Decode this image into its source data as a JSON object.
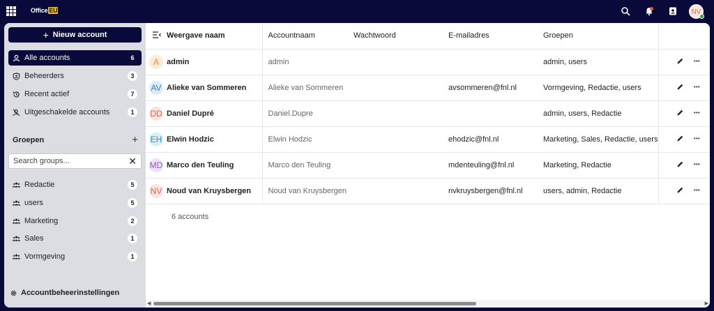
{
  "topbar": {
    "brand": "Office",
    "brand_suffix": "EU",
    "user_initials": "NV",
    "icons": [
      "apps-grid-icon",
      "search-icon",
      "bell-icon",
      "contacts-icon"
    ]
  },
  "sidebar": {
    "new_account_label": "Nieuw account",
    "nav": [
      {
        "label": "Alle accounts",
        "count": "6",
        "icon": "user-icon",
        "active": true
      },
      {
        "label": "Beheerders",
        "count": "3",
        "icon": "shield-user-icon",
        "active": false
      },
      {
        "label": "Recent actief",
        "count": "7",
        "icon": "history-icon",
        "active": false
      },
      {
        "label": "Uitgeschakelde accounts",
        "count": "1",
        "icon": "user-off-icon",
        "active": false
      }
    ],
    "groups_title": "Groepen",
    "search_placeholder": "Search groups...",
    "groups": [
      {
        "label": "Redactie",
        "count": "5"
      },
      {
        "label": "users",
        "count": "5"
      },
      {
        "label": "Marketing",
        "count": "2"
      },
      {
        "label": "Sales",
        "count": "1"
      },
      {
        "label": "Vormgeving",
        "count": "1"
      }
    ],
    "settings_label": "Accountbeheerinstellingen"
  },
  "table": {
    "headers": {
      "name": "Weergave naam",
      "account": "Accountnaam",
      "password": "Wachtwoord",
      "email": "E-mailadres",
      "groups": "Groepen"
    },
    "rows": [
      {
        "initials": "A",
        "avatar_bg": "#fdebd9",
        "avatar_fg": "#e0894a",
        "name": "admin",
        "account": "admin",
        "email": "",
        "groups": "admin, users"
      },
      {
        "initials": "AV",
        "avatar_bg": "#dcecfa",
        "avatar_fg": "#3b7fc4",
        "name": "Alieke van Sommeren",
        "account": "Alieke van Sommeren",
        "email": "avsommeren@fnl.nl",
        "groups": "Vormgeving, Redactie, users"
      },
      {
        "initials": "DD",
        "avatar_bg": "#fde3df",
        "avatar_fg": "#d9694f",
        "name": "Daniel Dupré",
        "account": "Daniel.Dupre",
        "email": "",
        "groups": "admin, users, Redactie"
      },
      {
        "initials": "EH",
        "avatar_bg": "#d9eff7",
        "avatar_fg": "#2f8fb3",
        "name": "Elwin Hodzic",
        "account": "Elwin Hodzic",
        "email": "ehodzic@fnl.nl",
        "groups": "Marketing, Sales, Redactie, users"
      },
      {
        "initials": "MD",
        "avatar_bg": "#ece3f7",
        "avatar_fg": "#8a5cc4",
        "name": "Marco den Teuling",
        "account": "Marco den Teuling",
        "email": "mdenteuling@fnl.nl",
        "groups": "Marketing, Redactie"
      },
      {
        "initials": "NV",
        "avatar_bg": "#fde3df",
        "avatar_fg": "#d9694f",
        "name": "Noud van Kruysbergen",
        "account": "Noud van Kruysbergen",
        "email": "nvkruysbergen@fnl.nl",
        "groups": "users, admin, Redactie"
      }
    ],
    "footer": "6 accounts"
  },
  "colors": {
    "navy": "#0a0a3a",
    "sidebar_bg": "#dcdce3",
    "status_online": "#2f9e44"
  }
}
